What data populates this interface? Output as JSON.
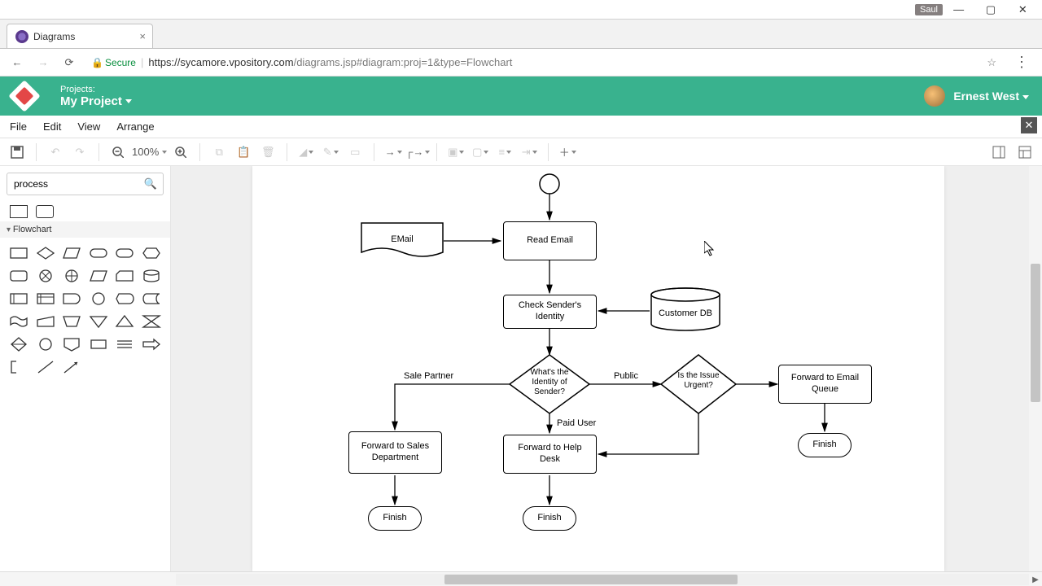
{
  "os": {
    "user_badge": "Saul"
  },
  "browser": {
    "tab_title": "Diagrams",
    "secure_label": "Secure",
    "url_host": "https://sycamore.vpository.com",
    "url_path": "/diagrams.jsp#diagram:proj=1&type=Flowchart"
  },
  "header": {
    "projects_label": "Projects:",
    "project_name": "My Project",
    "user_name": "Ernest West"
  },
  "menubar": [
    "File",
    "Edit",
    "View",
    "Arrange"
  ],
  "toolbar": {
    "zoom": "100%"
  },
  "sidebar": {
    "search_value": "process",
    "category": "Flowchart"
  },
  "diagram": {
    "nodes": {
      "email": "EMail",
      "read_email": "Read Email",
      "check_sender": "Check Sender's Identity",
      "customer_db": "Customer DB",
      "identity_q": "What's the Identity of Sender?",
      "urgent_q": "Is the Issue Urgent?",
      "fwd_sales": "Forward to Sales Department",
      "fwd_help": "Forward to Help Desk",
      "fwd_queue": "Forward to Email Queue",
      "finish1": "Finish",
      "finish2": "Finish",
      "finish3": "Finish"
    },
    "edge_labels": {
      "sale_partner": "Sale Partner",
      "public": "Public",
      "paid_user": "Paid User"
    }
  }
}
